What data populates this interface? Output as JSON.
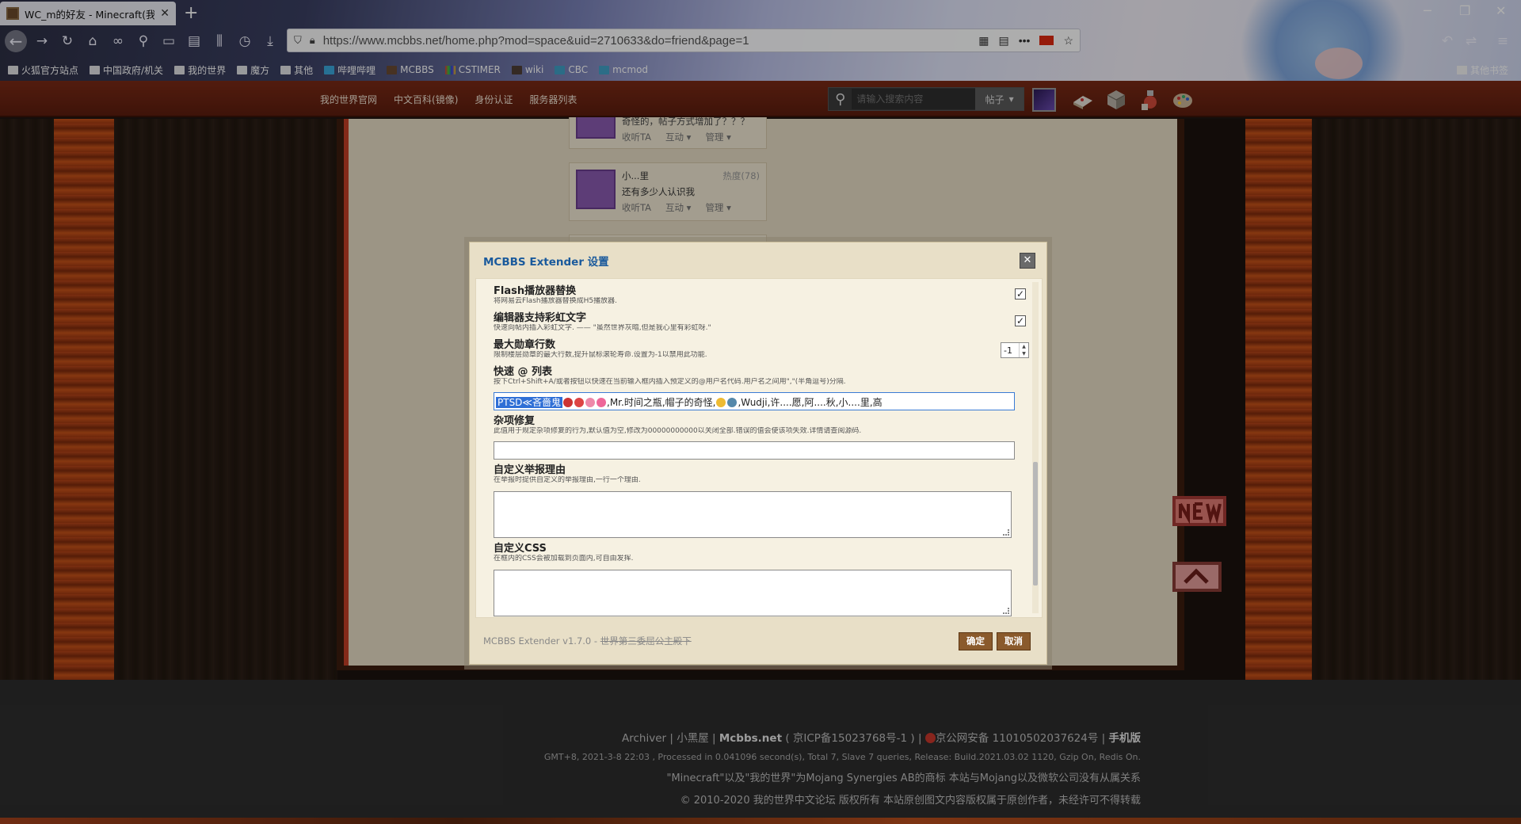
{
  "browser": {
    "tab_title": "WC_m的好友 - Minecraft(我的世界)中文论坛",
    "new_tab": "+",
    "url": "https://www.mcbbs.net/home.php?mod=space&uid=2710633&do=friend&page=1",
    "bookmarks": [
      "火狐官方站点",
      "中国政府/机关",
      "我的世界",
      "魔方",
      "其他",
      "哔哩哔哩",
      "MCBBS",
      "CSTIMER",
      "wiki",
      "CBC",
      "mcmod"
    ],
    "bookmarks_other": "其他书签",
    "window_controls": [
      "─",
      "❐",
      "✕"
    ]
  },
  "site": {
    "nav": [
      "我的世界官网",
      "中文百科(镜像)",
      "身份认证",
      "服务器列表"
    ],
    "search_placeholder": "请输入搜索内容",
    "search_type": "帖子"
  },
  "friends": [
    {
      "name": "",
      "status": "奇怪的，帖子方式增加了？？？",
      "follow": "收听TA",
      "interact": "互动",
      "manage": "管理",
      "heat": ""
    },
    {
      "name": "小...里",
      "status": "还有多少人认识我",
      "follow": "收听TA",
      "interact": "互动",
      "manage": "管理",
      "heat": "热度(78)"
    }
  ],
  "dialog": {
    "title": "MCBBS Extender 设置",
    "close": "✕",
    "options": {
      "flash": {
        "name": "Flash播放器替换",
        "desc": "将网易云Flash播放器替换成H5播放器.",
        "checked": "✓"
      },
      "rainbow": {
        "name": "编辑器支持彩虹文字",
        "desc": "快速向帖内插入彩虹文字. —— \"虽然世界灰暗,但是我心里有彩虹呀.\"",
        "checked": "✓"
      },
      "medal": {
        "name": "最大勋章行数",
        "desc": "限制楼层勋章的最大行数,提升鼠标滚轮寿命.设置为-1以禁用此功能.",
        "value": "-1"
      },
      "at": {
        "name": "快速 @ 列表",
        "desc": "按下Ctrl+Shift+A/或者按钮以快速在当前输入框内插入预定义的@用户名代码.用户名之间用\",\"(半角逗号)分隔.",
        "value_selected": "PTSD≪吝嗇鬼",
        "value_rest": ",Mr.时间之瓶,帽子的奇怪,",
        "value_tail": ",Wudji,许....愿,阿....秋,小....里,高"
      },
      "fix": {
        "name": "杂项修复",
        "desc": "此值用于规定杂项修复的行为,默认值为空,修改为00000000000以关闭全部.错误的值会使该项失效.详情请查阅源码.",
        "value": ""
      },
      "report": {
        "name": "自定义举报理由",
        "desc": "在举报时提供自定义的举报理由,一行一个理由."
      },
      "css": {
        "name": "自定义CSS",
        "desc": "在框内的CSS会被加载到页面内,可自由发挥."
      }
    },
    "version": "MCBBS Extender v1.7.0 - ",
    "version_strike": "世界第三委屈公主殿下",
    "ok": "确定",
    "cancel": "取消"
  },
  "footer": {
    "links": [
      "Archiver",
      "小黑屋",
      "Mcbbs.net"
    ],
    "icp": "( 京ICP备15023768号-1 )",
    "police": "京公网安备 11010502037624号",
    "mobile": "手机版",
    "stats": "GMT+8, 2021-3-8 22:03 , Processed in 0.041096 second(s), Total 7, Slave 7 queries, Release: Build.2021.03.02 1120, Gzip On, Redis On.",
    "trademark": "\"Minecraft\"以及\"我的世界\"为Mojang Synergies AB的商标 本站与Mojang以及微软公司没有从属关系",
    "copyright": "© 2010-2020 我的世界中文论坛 版权所有 本站原创图文内容版权属于原创作者，未经许可不得转载"
  },
  "colors": {
    "header_red": "#6b2412",
    "dialog_title": "#1a5a9c",
    "button_brown": "#8a5a2c",
    "lava": "#c5521a"
  }
}
